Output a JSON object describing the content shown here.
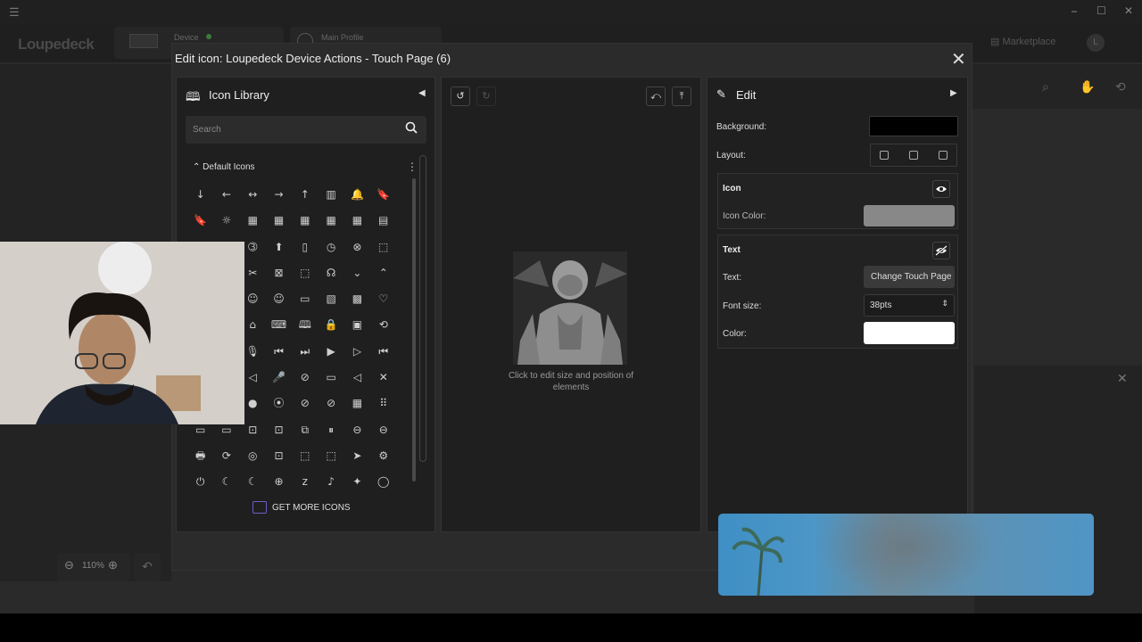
{
  "app": {
    "brand": "Loupedeck",
    "device_label": "Device",
    "profile_label": "Main Profile",
    "marketplace_label": "Marketplace",
    "avatar_letter": "L",
    "zoom_level": "110%"
  },
  "dialog": {
    "title": "Edit icon: Loupedeck Device Actions - Touch Page (6)"
  },
  "library": {
    "title": "Icon Library",
    "search_placeholder": "Search",
    "section_title": "Default Icons",
    "get_more_label": "GET MORE ICONS",
    "icons": [
      "↓",
      "←",
      "↔",
      "→",
      "↑",
      "▥",
      "🔔",
      "🔖",
      "🔖",
      "☼",
      "▦",
      "▦",
      "▦",
      "▦",
      "▦",
      "▤",
      "○",
      "○",
      "➂",
      "⬆",
      "▯",
      "◷",
      "⊗",
      "⬚",
      "⌬",
      "⌬",
      "✂",
      "⊠",
      "⬚",
      "☊",
      "⌄",
      "⌃",
      "☺",
      "☺",
      "☺",
      "☺",
      "▭",
      "▧",
      "▩",
      "♡",
      "⌂",
      "⌂",
      "⌂",
      "⌨",
      "🕮",
      "🔒",
      "▣",
      "⟲",
      "🎙",
      "🎙",
      "🎙",
      "⏮",
      "⏭",
      "▶",
      "▷",
      "⏮",
      "◁",
      "◁",
      "◁",
      "🎤",
      "⊘",
      "▭",
      "◁",
      "✕",
      "●",
      "●",
      "●",
      "⦿",
      "⊘",
      "⊘",
      "▦",
      "⠿",
      "▭",
      "▭",
      "⊡",
      "⊡",
      "⧉",
      "⏸",
      "⊖",
      "⊖",
      "🖶",
      "⟳",
      "◎",
      "⊡",
      "⬚",
      "⬚",
      "➤",
      "⚙",
      "⏻",
      "☾",
      "☾",
      "⊕",
      "z",
      "♪",
      "✦",
      "◯"
    ]
  },
  "preview": {
    "caption": "Click to edit size and position of elements"
  },
  "edit": {
    "title": "Edit",
    "background_label": "Background:",
    "background_color": "#000000",
    "layout_label": "Layout:",
    "icon_section": "Icon",
    "icon_color_label": "Icon Color:",
    "icon_color": "#888888",
    "text_section": "Text",
    "text_label": "Text:",
    "text_value": "Change Touch Page",
    "font_size_label": "Font size:",
    "font_size_value": "38pts",
    "color_label": "Color:",
    "text_color": "#ffffff"
  }
}
